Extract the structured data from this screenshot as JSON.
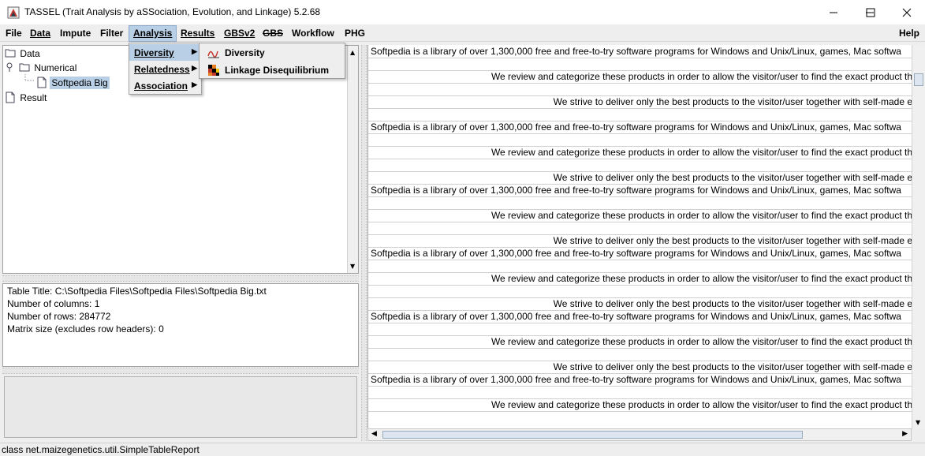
{
  "window": {
    "title": "TASSEL (Trait Analysis by aSSociation, Evolution, and Linkage) 5.2.68"
  },
  "menubar": {
    "items": [
      {
        "label": "File"
      },
      {
        "label": "Data"
      },
      {
        "label": "Impute"
      },
      {
        "label": "Filter"
      },
      {
        "label": "Analysis"
      },
      {
        "label": "Results"
      },
      {
        "label": "GBSv2"
      },
      {
        "label": "GBS"
      },
      {
        "label": "Workflow"
      },
      {
        "label": "PHG"
      }
    ],
    "help": "Help"
  },
  "analysis_menu": {
    "items": [
      {
        "label": "Diversity"
      },
      {
        "label": "Relatedness"
      },
      {
        "label": "Association"
      }
    ]
  },
  "diversity_submenu": {
    "items": [
      {
        "label": "Diversity"
      },
      {
        "label": "Linkage Disequilibrium"
      }
    ]
  },
  "tree": {
    "data": "Data",
    "numerical": "Numerical",
    "leaf": "Softpedia Big",
    "result": "Result"
  },
  "info": {
    "lines": [
      "Table Title: C:\\Softpedia Files\\Softpedia Files\\Softpedia Big.txt",
      "Number of columns: 1",
      "Number of rows: 284772",
      "Matrix size (excludes row headers): 0"
    ]
  },
  "report": {
    "rows": [
      "Softpedia is a library of over 1,300,000 free and free-to-try software programs for Windows and Unix/Linux, games, Mac softwa",
      "",
      "We review and categorize these products in order to allow the visitor/user to find the exact product th",
      "",
      "We strive to deliver only the best products to the visitor/user together with self-made e",
      "",
      "Softpedia is a library of over 1,300,000 free and free-to-try software programs for Windows and Unix/Linux, games, Mac softwa",
      "",
      "We review and categorize these products in order to allow the visitor/user to find the exact product th",
      "",
      "We strive to deliver only the best products to the visitor/user together with self-made e",
      "Softpedia is a library of over 1,300,000 free and free-to-try software programs for Windows and Unix/Linux, games, Mac softwa",
      "",
      "We review and categorize these products in order to allow the visitor/user to find the exact product th",
      "",
      "We strive to deliver only the best products to the visitor/user together with self-made e",
      "Softpedia is a library of over 1,300,000 free and free-to-try software programs for Windows and Unix/Linux, games, Mac softwa",
      "",
      "We review and categorize these products in order to allow the visitor/user to find the exact product th",
      "",
      "We strive to deliver only the best products to the visitor/user together with self-made e",
      "Softpedia is a library of over 1,300,000 free and free-to-try software programs for Windows and Unix/Linux, games, Mac softwa",
      "",
      "We review and categorize these products in order to allow the visitor/user to find the exact product th",
      "",
      "We strive to deliver only the best products to the visitor/user together with self-made e",
      "Softpedia is a library of over 1,300,000 free and free-to-try software programs for Windows and Unix/Linux, games, Mac softwa",
      "",
      "We review and categorize these products in order to allow the visitor/user to find the exact product th"
    ]
  },
  "status": {
    "text": "class net.maizegenetics.util.SimpleTableReport"
  },
  "colors": {
    "selection": "#b8cfe5",
    "menu_bg": "#eeeeee",
    "panel_bg": "#ffffff"
  },
  "icons": [
    "tassel-app-icon",
    "minimize-icon",
    "maximize-icon",
    "close-icon",
    "folder-icon",
    "file-icon",
    "diversity-icon",
    "ld-icon"
  ]
}
